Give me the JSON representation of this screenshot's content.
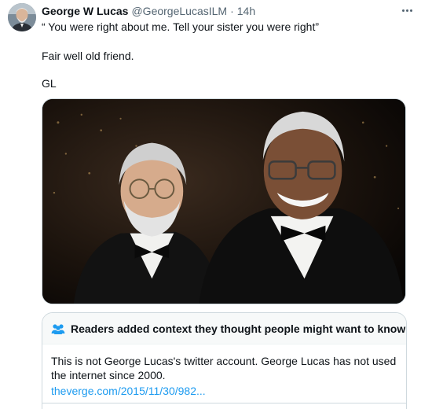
{
  "tweet": {
    "author_name": "George W Lucas",
    "handle": "@GeorgeLucasILM",
    "separator": "·",
    "timestamp": "14h",
    "more_icon": "more-horizontal-icon",
    "text_lines": [
      "“ You were right about me. Tell your sister you were right”",
      "Fair well old friend.",
      "GL"
    ]
  },
  "community_note": {
    "icon": "people-icon",
    "title": "Readers added context they thought people might want to know",
    "body": "This is not George Lucas's twitter account. George Lucas has not used the internet since 2000.",
    "link_text": "theverge.com/2015/11/30/982..."
  },
  "colors": {
    "text": "#0f1419",
    "secondary": "#536471",
    "link": "#1d9bf0",
    "border": "#cfd9de",
    "note_header_bg": "#f7f9f9"
  }
}
